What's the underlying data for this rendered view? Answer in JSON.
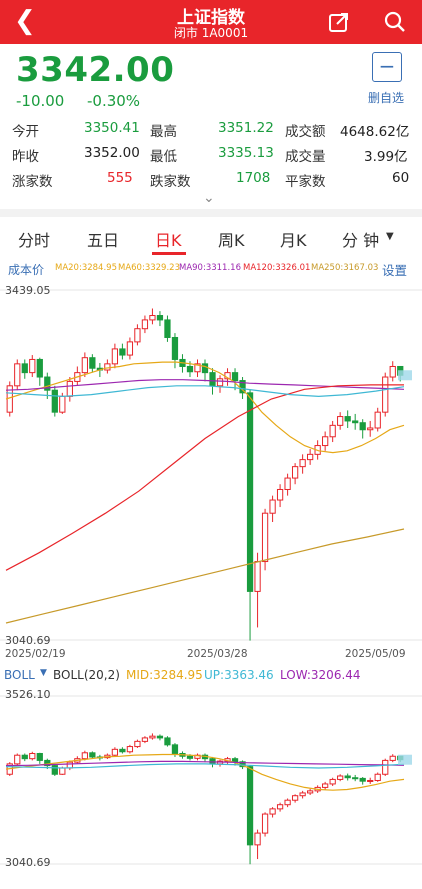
{
  "header": {
    "title": "上证指数",
    "subtitle": "闭市 1A0001",
    "add_label": "删自选"
  },
  "quote": {
    "price": "3342.00",
    "change": "-10.00",
    "change_pct": "-0.30%",
    "open_label": "今开",
    "open": "3350.41",
    "high_label": "最高",
    "high": "3351.22",
    "amount_label": "成交额",
    "amount": "4648.62亿",
    "prev_close_label": "昨收",
    "prev_close": "3352.00",
    "low_label": "最低",
    "low": "3335.13",
    "volume_label": "成交量",
    "volume": "3.99亿",
    "up_count_label": "涨家数",
    "up_count": "555",
    "down_count_label": "跌家数",
    "down_count": "1708",
    "flat_count_label": "平家数",
    "flat_count": "60"
  },
  "tabs": [
    "分时",
    "五日",
    "日K",
    "周K",
    "月K",
    "分 钟"
  ],
  "active_tab": "日K",
  "kline": {
    "cost_label": "成本价",
    "settings_label": "设置",
    "ma": [
      {
        "text": "MA20:3284.95",
        "color": "#e6a817"
      },
      {
        "text": "MA60:3329.23",
        "color": "#e6a817"
      },
      {
        "text": "MA90:3311.16",
        "color": "#9c27b0"
      },
      {
        "text": "MA120:3326.01",
        "color": "#e8252a"
      },
      {
        "text": "MA250:3167.03",
        "color": "#c79a2a"
      }
    ],
    "y_max": "3439.05",
    "y_min": "3040.69",
    "dates": [
      "2025/02/19",
      "2025/03/28",
      "2025/05/09"
    ]
  },
  "boll": {
    "name": "BOLL",
    "params": "BOLL(20,2)",
    "mid": "MID:3284.95",
    "up": "UP:3363.46",
    "low": "LOW:3206.44",
    "y_max": "3526.10",
    "y_min": "3040.69"
  },
  "colors": {
    "up": "#e8252a",
    "down": "#1a9c3e",
    "header": "#e8252a",
    "link": "#3a6fb4"
  },
  "chart_data": {
    "type": "candlestick",
    "ylim": [
      3040.69,
      3439.05
    ],
    "start_date": "2025/02/19",
    "end_date": "2025/05/09",
    "ohlc": [
      [
        3300,
        3330,
        3295,
        3335
      ],
      [
        3330,
        3355,
        3325,
        3360
      ],
      [
        3355,
        3345,
        3338,
        3360
      ],
      [
        3345,
        3360,
        3340,
        3365
      ],
      [
        3360,
        3340,
        3330,
        3362
      ],
      [
        3340,
        3325,
        3315,
        3345
      ],
      [
        3325,
        3300,
        3295,
        3330
      ],
      [
        3300,
        3318,
        3298,
        3322
      ],
      [
        3318,
        3335,
        3312,
        3340
      ],
      [
        3335,
        3345,
        3330,
        3352
      ],
      [
        3345,
        3362,
        3340,
        3368
      ],
      [
        3362,
        3350,
        3345,
        3366
      ],
      [
        3350,
        3348,
        3340,
        3356
      ],
      [
        3348,
        3355,
        3344,
        3360
      ],
      [
        3355,
        3372,
        3350,
        3378
      ],
      [
        3372,
        3365,
        3360,
        3378
      ],
      [
        3365,
        3380,
        3360,
        3385
      ],
      [
        3380,
        3395,
        3376,
        3400
      ],
      [
        3395,
        3405,
        3390,
        3410
      ],
      [
        3405,
        3410,
        3400,
        3418
      ],
      [
        3410,
        3405,
        3398,
        3415
      ],
      [
        3405,
        3385,
        3380,
        3410
      ],
      [
        3385,
        3360,
        3350,
        3390
      ],
      [
        3360,
        3352,
        3345,
        3366
      ],
      [
        3352,
        3346,
        3340,
        3358
      ],
      [
        3346,
        3355,
        3340,
        3360
      ],
      [
        3355,
        3345,
        3335,
        3360
      ],
      [
        3345,
        3330,
        3320,
        3350
      ],
      [
        3330,
        3338,
        3322,
        3342
      ],
      [
        3338,
        3345,
        3330,
        3350
      ],
      [
        3345,
        3336,
        3325,
        3350
      ],
      [
        3336,
        3322,
        3315,
        3340
      ],
      [
        3322,
        3096,
        3040,
        3326
      ],
      [
        3096,
        3130,
        3055,
        3140
      ],
      [
        3130,
        3185,
        3120,
        3190
      ],
      [
        3185,
        3200,
        3175,
        3205
      ],
      [
        3200,
        3212,
        3192,
        3218
      ],
      [
        3212,
        3225,
        3205,
        3230
      ],
      [
        3225,
        3238,
        3218,
        3242
      ],
      [
        3238,
        3246,
        3230,
        3252
      ],
      [
        3246,
        3252,
        3240,
        3258
      ],
      [
        3252,
        3262,
        3246,
        3268
      ],
      [
        3262,
        3272,
        3256,
        3278
      ],
      [
        3272,
        3285,
        3266,
        3290
      ],
      [
        3285,
        3295,
        3280,
        3300
      ],
      [
        3295,
        3290,
        3282,
        3302
      ],
      [
        3290,
        3288,
        3280,
        3298
      ],
      [
        3288,
        3280,
        3270,
        3292
      ],
      [
        3280,
        3282,
        3272,
        3290
      ],
      [
        3282,
        3300,
        3278,
        3305
      ],
      [
        3300,
        3340,
        3295,
        3345
      ],
      [
        3340,
        3352,
        3335,
        3358
      ],
      [
        3352,
        3342,
        3335,
        3351
      ]
    ],
    "series": [
      {
        "name": "MA20",
        "color": "#e6a817",
        "values": [
          3315,
          3320,
          3325,
          3330,
          3335,
          3340,
          3345,
          3350,
          3352,
          3355,
          3356,
          3357,
          3357,
          3355,
          3352,
          3345,
          3335,
          3320,
          3300,
          3285,
          3272,
          3262,
          3256,
          3254,
          3256,
          3262,
          3270,
          3280,
          3285
        ]
      },
      {
        "name": "MA90",
        "color": "#9c27b0",
        "values": [
          3325,
          3326,
          3328,
          3330,
          3332,
          3334,
          3336,
          3337,
          3337,
          3336,
          3335,
          3333,
          3332,
          3331,
          3330,
          3329,
          3328,
          3327,
          3326
        ]
      },
      {
        "name": "MA120",
        "color": "#e8252a",
        "values": [
          3120,
          3140,
          3162,
          3185,
          3210,
          3240,
          3270,
          3295,
          3315,
          3326,
          3330,
          3331,
          3331
        ]
      },
      {
        "name": "MA250",
        "color": "#c79a2a",
        "values": [
          3060,
          3070,
          3080,
          3090,
          3100,
          3110,
          3120,
          3130,
          3140,
          3150,
          3158,
          3167
        ]
      },
      {
        "name": "MA60",
        "color": "#3fb8d4",
        "values": [
          3322,
          3320,
          3318,
          3320,
          3324,
          3328,
          3330,
          3330,
          3328,
          3324,
          3320,
          3318,
          3320,
          3324,
          3329
        ]
      }
    ]
  }
}
